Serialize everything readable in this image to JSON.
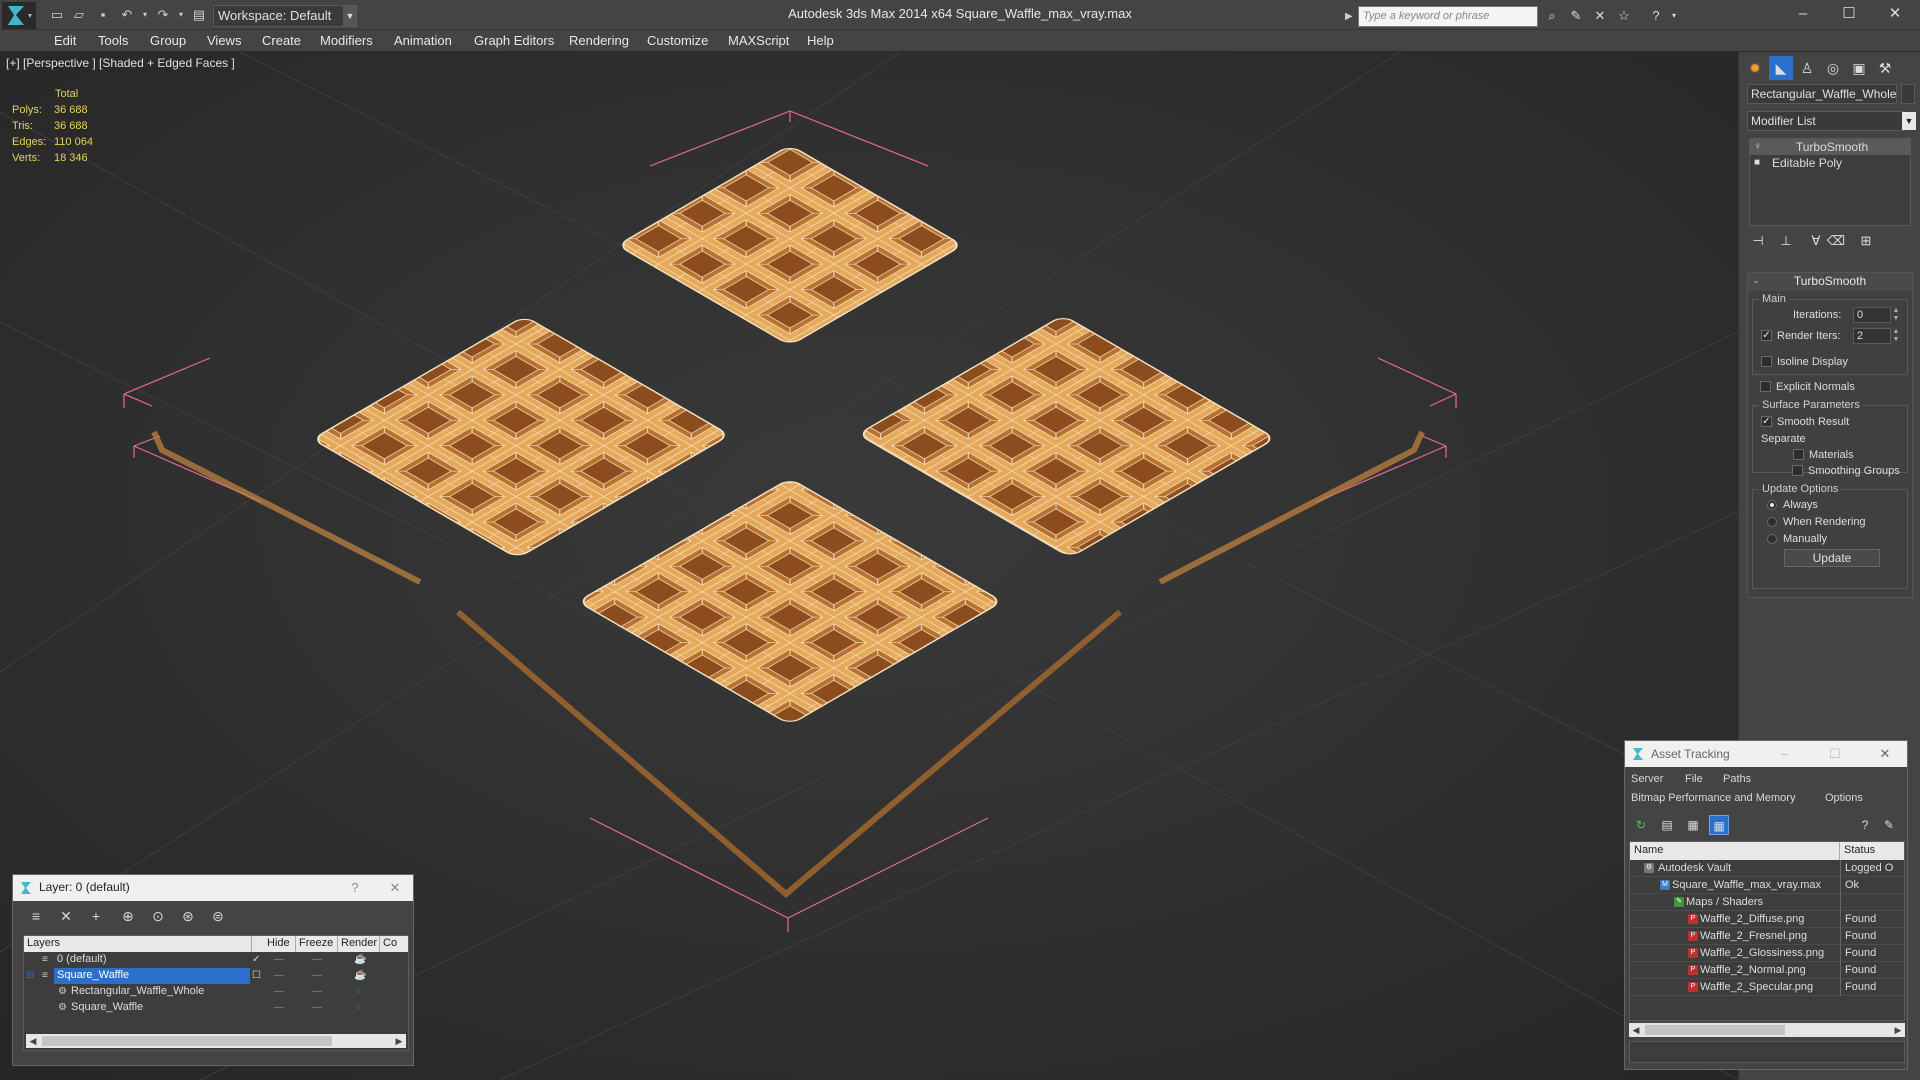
{
  "app": {
    "window_title": "Autodesk 3ds Max 2014 x64      Square_Waffle_max_vray.max",
    "workspace": "Workspace: Default",
    "search_placeholder": "Type a keyword or phrase"
  },
  "menu": [
    "Edit",
    "Tools",
    "Group",
    "Views",
    "Create",
    "Modifiers",
    "Animation",
    "Graph Editors",
    "Rendering",
    "Customize",
    "MAXScript",
    "Help"
  ],
  "viewport": {
    "label": "[+] [Perspective ] [Shaded + Edged Faces ]",
    "stats": {
      "header": "Total",
      "rows": [
        {
          "label": "Polys:",
          "value": "36 688"
        },
        {
          "label": "Tris:",
          "value": "36 688"
        },
        {
          "label": "Edges:",
          "value": "110 064"
        },
        {
          "label": "Verts:",
          "value": "18 346"
        }
      ]
    },
    "colors": {
      "waffle": "#d89a4a",
      "wire": "#f4e2c2",
      "bbox": "#e56a9a",
      "grid": "#3c3c3c"
    }
  },
  "command_panel": {
    "object_name": "Rectangular_Waffle_Whole",
    "modifier_list": "Modifier List",
    "stack": [
      "TurboSmooth",
      "Editable Poly"
    ],
    "rollout": {
      "title": "TurboSmooth",
      "main_group": "Main",
      "iterations_label": "Iterations:",
      "iterations_value": "0",
      "render_iters_label": "Render Iters:",
      "render_iters_value": "2",
      "isoline": "Isoline Display",
      "explicit_normals": "Explicit Normals",
      "surface_group": "Surface Parameters",
      "smooth_result": "Smooth Result",
      "separate": "Separate",
      "materials": "Materials",
      "smoothing_groups": "Smoothing Groups",
      "update_group": "Update Options",
      "always": "Always",
      "when_rendering": "When Rendering",
      "manually": "Manually",
      "update_button": "Update"
    }
  },
  "layer_dialog": {
    "title": "Layer: 0 (default)",
    "headers": [
      "Layers",
      "Hide",
      "Freeze",
      "Render",
      "Co"
    ],
    "rows": [
      {
        "name": "0 (default)"
      },
      {
        "name": "Square_Waffle"
      },
      {
        "name": "Rectangular_Waffle_Whole"
      },
      {
        "name": "Square_Waffle"
      }
    ]
  },
  "asset_dialog": {
    "title": "Asset Tracking",
    "menu": [
      "Server",
      "File",
      "Paths",
      "Bitmap Performance and Memory",
      "Options"
    ],
    "headers": [
      "Name",
      "Status"
    ],
    "rows": [
      {
        "name": "Autodesk Vault",
        "status": "Logged O"
      },
      {
        "name": "Square_Waffle_max_vray.max",
        "status": "Ok"
      },
      {
        "name": "Maps / Shaders",
        "status": ""
      },
      {
        "name": "Waffle_2_Diffuse.png",
        "status": "Found"
      },
      {
        "name": "Waffle_2_Fresnel.png",
        "status": "Found"
      },
      {
        "name": "Waffle_2_Glossiness.png",
        "status": "Found"
      },
      {
        "name": "Waffle_2_Normal.png",
        "status": "Found"
      },
      {
        "name": "Waffle_2_Specular.png",
        "status": "Found"
      }
    ]
  }
}
